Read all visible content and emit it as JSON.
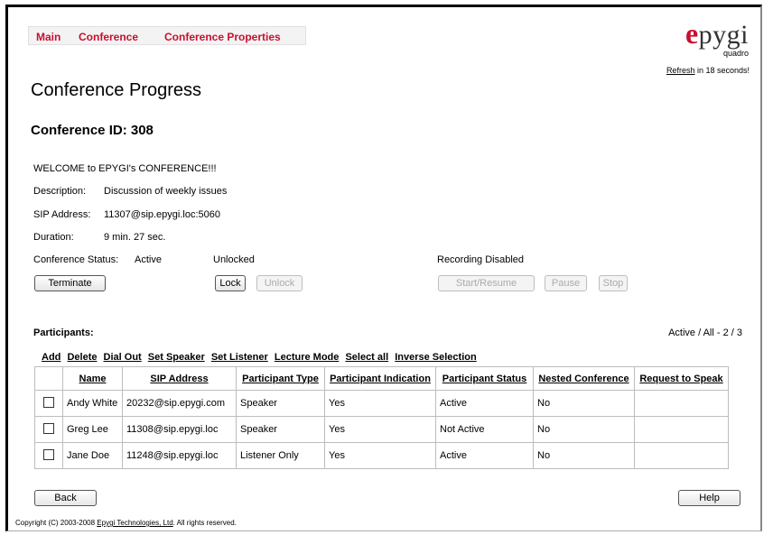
{
  "breadcrumbs": [
    "Main",
    "Conference",
    "Conference Properties"
  ],
  "logo": {
    "brand": "epygi",
    "sub": "quadro"
  },
  "refresh": {
    "link": "Refresh",
    "suffix": " in 18 seconds!"
  },
  "page_title": "Conference Progress",
  "conference_id": "Conference ID: 308",
  "welcome": "WELCOME to EPYGI's CONFERENCE!!!",
  "description_label": "Description:",
  "description_value": "Discussion of weekly issues",
  "sip_label": "SIP Address:",
  "sip_value": "11307@sip.epygi.loc:5060",
  "duration_label": "Duration:",
  "duration_value": "9 min. 27 sec.",
  "status_label": "Conference Status:",
  "status_value": "Active",
  "lock_state": "Unlocked",
  "recording_state": "Recording Disabled",
  "buttons": {
    "terminate": "Terminate",
    "lock": "Lock",
    "unlock": "Unlock",
    "start_resume": "Start/Resume",
    "pause": "Pause",
    "stop": "Stop",
    "back": "Back",
    "help": "Help"
  },
  "participants_label": "Participants:",
  "participants_count": "Active / All - 2 / 3",
  "actions": [
    "Add",
    "Delete",
    "Dial Out",
    "Set Speaker",
    "Set Listener",
    "Lecture Mode",
    "Select all",
    "Inverse Selection"
  ],
  "columns": [
    "Name",
    "SIP Address",
    "Participant Type",
    "Participant Indication",
    "Participant Status",
    "Nested Conference",
    "Request to Speak"
  ],
  "rows": [
    {
      "name": "Andy White",
      "sip": "20232@sip.epygi.com",
      "type": "Speaker",
      "indication": "Yes",
      "status": "Active",
      "nested": "No",
      "request": ""
    },
    {
      "name": "Greg Lee",
      "sip": "11308@sip.epygi.loc",
      "type": "Speaker",
      "indication": "Yes",
      "status": "Not Active",
      "nested": "No",
      "request": ""
    },
    {
      "name": "Jane Doe",
      "sip": "11248@sip.epygi.loc",
      "type": "Listener Only",
      "indication": "Yes",
      "status": "Active",
      "nested": "No",
      "request": ""
    }
  ],
  "footer": {
    "prefix": "Copyright (C) 2003-2008 ",
    "company": "Epygi Technologies, Ltd",
    "suffix": ". All rights reserved."
  }
}
